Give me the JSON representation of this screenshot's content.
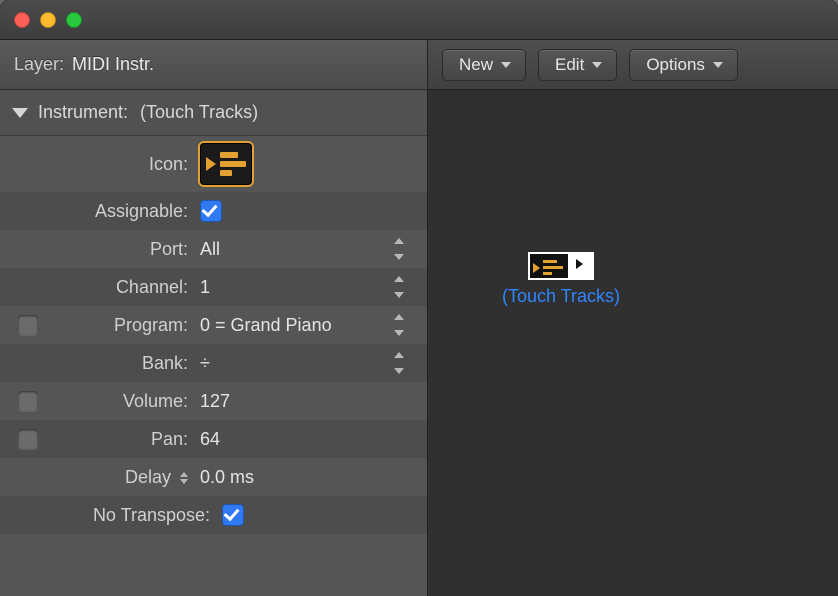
{
  "layer_label": "Layer:",
  "layer_value": "MIDI Instr.",
  "instrument_label": "Instrument:",
  "instrument_value": "(Touch Tracks)",
  "props": {
    "icon_label": "Icon:",
    "assignable_label": "Assignable:",
    "assignable_checked": true,
    "port_label": "Port:",
    "port_value": "All",
    "channel_label": "Channel:",
    "channel_value": "1",
    "program_label": "Program:",
    "program_value": "0 = Grand Piano",
    "bank_label": "Bank:",
    "bank_value": "÷",
    "volume_label": "Volume:",
    "volume_value": "127",
    "pan_label": "Pan:",
    "pan_value": "64",
    "delay_label": "Delay",
    "delay_value": "0.0 ms",
    "notranspose_label": "No Transpose:",
    "notranspose_checked": true
  },
  "toolbar": {
    "new": "New",
    "edit": "Edit",
    "options": "Options"
  },
  "object_label": "(Touch Tracks)"
}
